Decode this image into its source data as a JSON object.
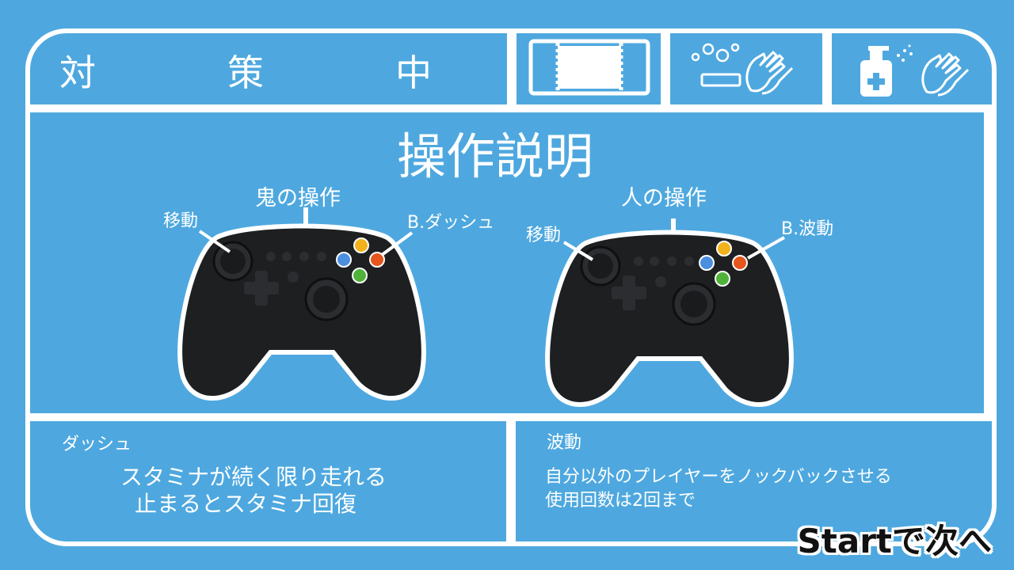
{
  "header": {
    "title": "対　策　中",
    "icons": [
      "partition-icon",
      "handwash-icon",
      "sanitizer-icon"
    ]
  },
  "main": {
    "title": "操作説明",
    "oni": {
      "heading": "鬼の操作",
      "move_label": "移動",
      "b_label": "B.ダッシュ"
    },
    "human": {
      "heading": "人の操作",
      "move_label": "移動",
      "b_label": "B.波動"
    }
  },
  "panels": {
    "dash": {
      "heading": "ダッシュ",
      "line1": "スタミナが続く限り走れる",
      "line2": "止まるとスタミナ回復"
    },
    "wave": {
      "heading": "波動",
      "line1": "自分以外のプレイヤーをノックバックさせる",
      "line2": "使用回数は2回まで"
    }
  },
  "footer": {
    "start_hint": "Startで次へ"
  },
  "colors": {
    "background": "#4ea8df",
    "frame": "#ffffff",
    "button_yellow": "#f2b21a",
    "button_blue": "#4a8fe0",
    "button_green": "#4fb33a",
    "button_orange": "#e4561c"
  }
}
